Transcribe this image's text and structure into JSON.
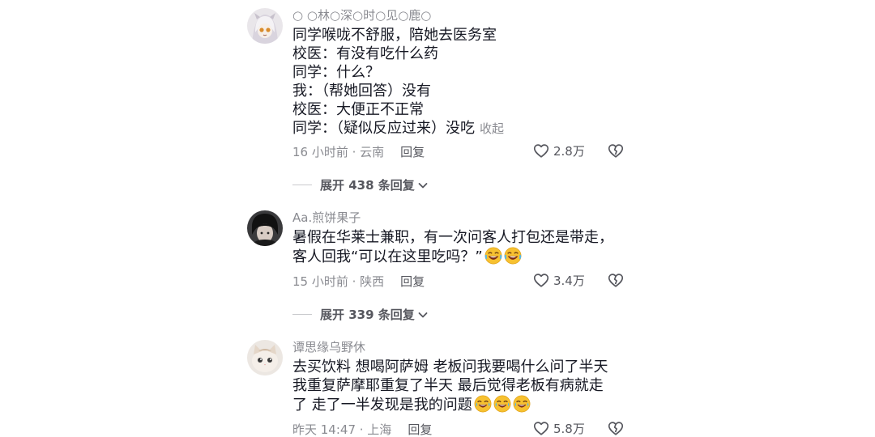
{
  "comments": [
    {
      "username": "○ ○林○深○时○见○鹿○",
      "lines": [
        "同学喉咙不舒服，陪她去医务室",
        "校医：有没有吃什么药",
        "同学：什么？",
        "我：（帮她回答）没有",
        "校医：大便正不正常",
        "同学：（疑似反应过来）没吃"
      ],
      "collapse_label": "收起",
      "time_location": "16 小时前 · 云南",
      "reply_label": "回复",
      "likes": "2.8万",
      "expand_label": "展开 438 条回复"
    },
    {
      "username": "Aa.煎饼果子",
      "lines": [
        "暑假在华莱士兼职，有一次问客人打包还是带走，",
        "客人回我“可以在这里吃吗？”"
      ],
      "time_location": "15 小时前 · 陕西",
      "reply_label": "回复",
      "likes": "3.4万",
      "expand_label": "展开 339 条回复"
    },
    {
      "username": "谭思缘乌野休",
      "lines": [
        "去买饮料  想喝阿萨姆  老板问我要喝什么问了半天",
        "我重复萨摩耶重复了半天  最后觉得老板有病就走",
        "了  走了一半发现是我的问题"
      ],
      "time_location": "昨天 14:47 · 上海",
      "reply_label": "回复",
      "likes": "5.8万"
    }
  ],
  "icons": {
    "like": "heart-outline-icon",
    "dislike": "broken-heart-icon",
    "expand": "chevron-down-icon",
    "emoji_laugh": "rolling-laugh-emoji",
    "emoji_tears": "tears-of-joy-emoji"
  },
  "colors": {
    "text_primary": "#161823",
    "text_secondary": "#8a8b91",
    "meta_dark": "#56575e"
  }
}
